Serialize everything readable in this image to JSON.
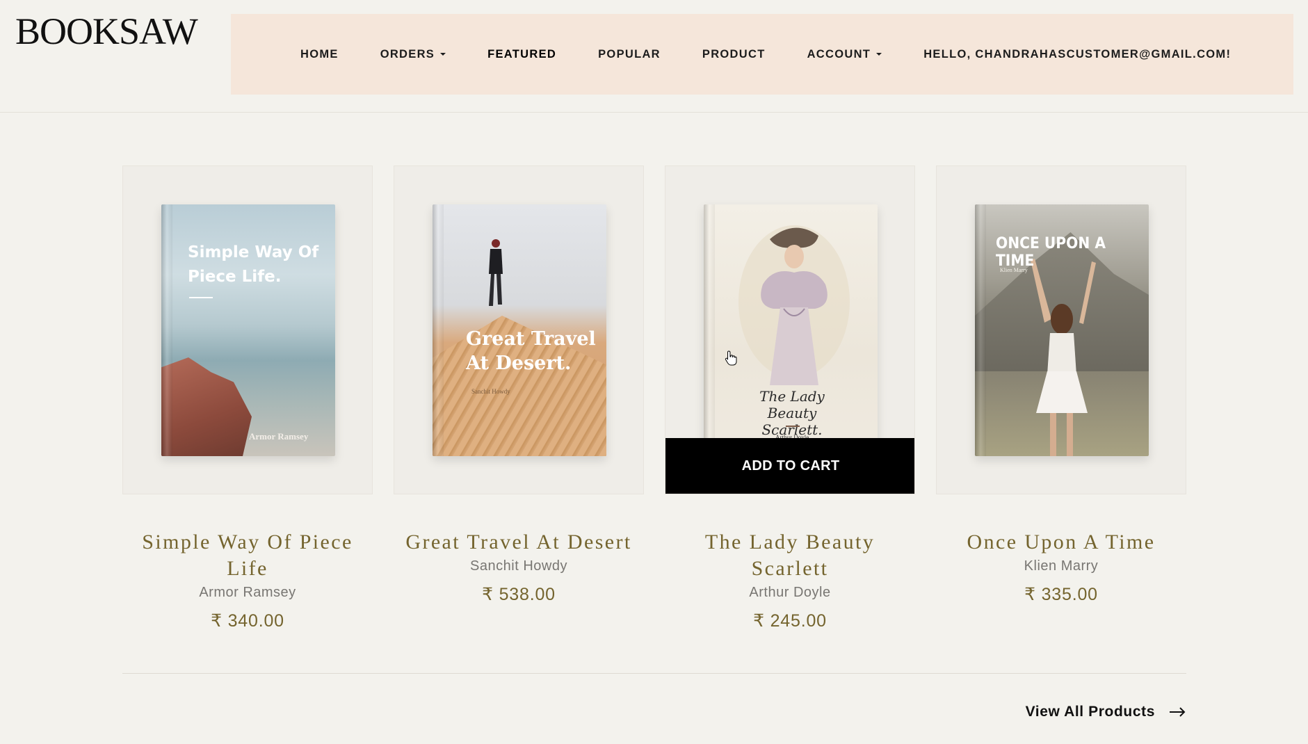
{
  "brand": {
    "logo_bold": "BOOK",
    "logo_light": "SAW"
  },
  "nav": {
    "home": "HOME",
    "orders": "ORDERS",
    "featured": "FEATURED",
    "popular": "POPULAR",
    "product": "PRODUCT",
    "account": "ACCOUNT",
    "greeting": "HELLO, CHANDRAHASCUSTOMER@GMAIL.COM!"
  },
  "products": [
    {
      "title": "Simple Way Of Piece Life",
      "author": "Armor Ramsey",
      "price": "₹ 340.00",
      "cover": {
        "title_line1": "Simple Way Of",
        "title_line2": "Piece Life.",
        "author": "Armor Ramsey"
      }
    },
    {
      "title": "Great Travel At Desert",
      "author": "Sanchit Howdy",
      "price": "₹ 538.00",
      "cover": {
        "title_line1": "Great Travel",
        "title_line2": "At Desert.",
        "author": "Sanchit Howdy"
      }
    },
    {
      "title": "The Lady Beauty Scarlett",
      "author": "Arthur Doyle",
      "price": "₹ 245.00",
      "cover": {
        "title_line1": "The Lady Beauty",
        "title_line2": "Scarlett.",
        "author": "Arthur Doyle"
      }
    },
    {
      "title": "Once Upon A Time",
      "author": "Klien Marry",
      "price": "₹ 335.00",
      "cover": {
        "title_line1": "ONCE UPON A TIME",
        "author": "Klien Marry"
      }
    }
  ],
  "add_to_cart": "ADD TO CART",
  "view_all": "View All Products",
  "colors": {
    "nav_bg": "#f5e6da",
    "page_bg": "#f3f2ed",
    "title_gold": "#74642e",
    "button_bg": "#000000"
  }
}
